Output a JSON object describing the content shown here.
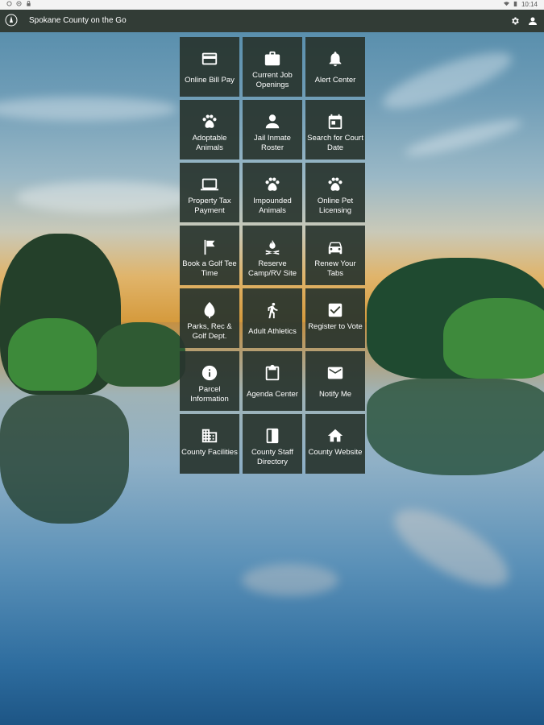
{
  "status_bar": {
    "time": "10:14"
  },
  "app_bar": {
    "title": "Spokane County on the Go",
    "logo_icon": "county-seal-icon",
    "actions": [
      "gear-icon",
      "user-icon"
    ]
  },
  "tiles": [
    {
      "label": "Online Bill Pay",
      "icon": "credit-card-icon"
    },
    {
      "label": "Current Job Openings",
      "icon": "briefcase-icon"
    },
    {
      "label": "Alert Center",
      "icon": "bell-icon"
    },
    {
      "label": "Adoptable Animals",
      "icon": "paw-icon"
    },
    {
      "label": "Jail Inmate Roster",
      "icon": "person-icon"
    },
    {
      "label": "Search for Court Date",
      "icon": "calendar-icon"
    },
    {
      "label": "Property Tax Payment",
      "icon": "laptop-icon"
    },
    {
      "label": "Impounded Animals",
      "icon": "paw-icon"
    },
    {
      "label": "Online Pet Licensing",
      "icon": "paw-icon"
    },
    {
      "label": "Book a Golf Tee Time",
      "icon": "flag-icon"
    },
    {
      "label": "Reserve Camp/RV Site",
      "icon": "campfire-icon"
    },
    {
      "label": "Renew Your Tabs",
      "icon": "car-icon"
    },
    {
      "label": "Parks, Rec & Golf Dept.",
      "icon": "leaf-icon"
    },
    {
      "label": "Adult Athletics",
      "icon": "walking-icon"
    },
    {
      "label": "Register to Vote",
      "icon": "checkbox-icon"
    },
    {
      "label": "Parcel Information",
      "icon": "info-icon"
    },
    {
      "label": "Agenda Center",
      "icon": "clipboard-icon"
    },
    {
      "label": "Notify Me",
      "icon": "mail-icon"
    },
    {
      "label": "County Facilities",
      "icon": "building-icon"
    },
    {
      "label": "County Staff Directory",
      "icon": "book-icon"
    },
    {
      "label": "County Website",
      "icon": "home-icon"
    }
  ],
  "colors": {
    "app_bar": "#323c36",
    "tile": "#28342e",
    "text": "#ffffff"
  }
}
